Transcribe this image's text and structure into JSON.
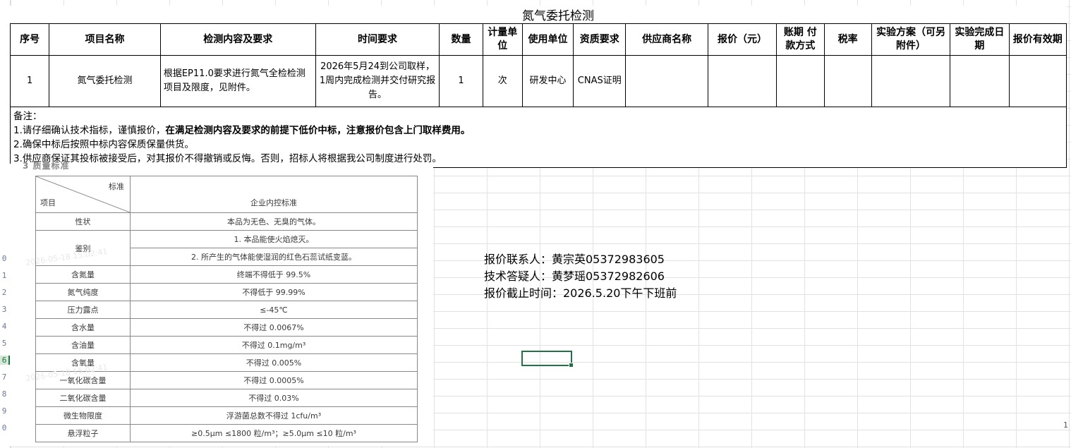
{
  "sheet": {
    "title": "氮气委托检测",
    "row_numbers": [
      "0",
      "1",
      "2",
      "3",
      "4",
      "5",
      "6",
      "7",
      "8",
      "9",
      "0"
    ],
    "right_edge_mark": "1"
  },
  "table": {
    "headers": [
      "序号",
      "项目名称",
      "检测内容及要求",
      "时间要求",
      "数量",
      "计量单位",
      "使用单位",
      "资质要求",
      "供应商名称",
      "报价（元）",
      "账期 付款方式",
      "税率",
      "实验方案（可另附件）",
      "实验完成日期",
      "报价有效期"
    ],
    "row": {
      "index": "1",
      "project": "氮气委托检测",
      "content": "根据EP11.0要求进行氮气全检检测项目及限度，见附件。",
      "time": "2026年5月24到公司取样，1周内完成检测并交付研究报告。",
      "quantity": "1",
      "unit": "次",
      "department": "研发中心",
      "qualification": "CNAS证明",
      "supplier": "",
      "price": "",
      "payment_terms": "",
      "tax_rate": "",
      "plan": "",
      "completion_date": "",
      "validity": ""
    },
    "remarks": {
      "label": "备注：",
      "line1_prefix": "1.请仔细确认技术指标，谨慎报价，",
      "line1_bold": "在满足检测内容及要求的前提下低价中标，注意报价包含上门取样费用。",
      "line2": "2.确保中标后按照中标内容保质保量供货。",
      "line3": "3.供应商保证其投标被接受后，对其报价不得撤销或反悔。否则，招标人将根据我公司制度进行处罚。"
    }
  },
  "standard_image": {
    "caption": "3 质量标准",
    "header_standard": "标准",
    "header_item": "项目",
    "header_column": "企业内控标准",
    "rows": [
      {
        "item": "性状",
        "value": "本品为无色、无臭的气体。"
      },
      {
        "item": "鉴别",
        "value": "1. 本品能使火焰熄灭。",
        "value2": "2. 所产生的气体能使湿润的红色石蕊试纸变蓝。"
      },
      {
        "item": "含氮量",
        "value": "终端不得低于 99.5%"
      },
      {
        "item": "氮气纯度",
        "value": "不得低于 99.99%"
      },
      {
        "item": "压力露点",
        "value": "≤-45℃"
      },
      {
        "item": "含水量",
        "value": "不得过 0.0067%"
      },
      {
        "item": "含油量",
        "value": "不得过 0.1mg/m³"
      },
      {
        "item": "含氧量",
        "value": "不得过 0.005%"
      },
      {
        "item": "一氧化碳含量",
        "value": "不得过 0.0005%"
      },
      {
        "item": "二氧化碳含量",
        "value": "不得过 0.03%"
      },
      {
        "item": "微生物限度",
        "value": "浮游菌总数不得过 1cfu/m³"
      },
      {
        "item": "悬浮粒子",
        "value": "≥0.5μm ≤1800 粒/m³；≥5.0μm ≤10 粒/m³"
      }
    ],
    "watermark": "2026-05-18 15:02:41"
  },
  "contacts": {
    "quote_contact": "报价联系人：黄宗英05372983605",
    "tech_contact": "技术答疑人：黄梦瑶05372982606",
    "deadline": "报价截止时间：2026.5.20下午下班前"
  },
  "colors": {
    "selection": "#217346",
    "grid": "#e2e2e2"
  }
}
